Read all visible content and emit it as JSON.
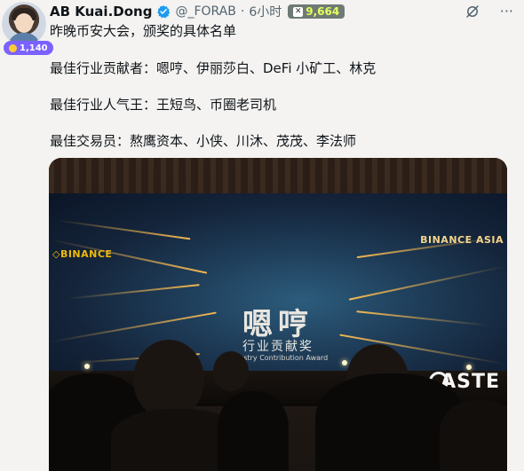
{
  "author": {
    "name": "AB Kuai.Dong",
    "handle": "@_FORAB",
    "separator": "·",
    "time": "6小时",
    "avatar_badge_count": "1,140",
    "score": "9,664"
  },
  "tweet": {
    "line1": "昨晚币安大会，颁奖的具体名单",
    "line2": "最佳行业贡献者：嗯哼、伊丽莎白、DeFi 小矿工、林克",
    "line3": "最佳行业人气王：王短鸟、币圈老司机",
    "line4": "最佳交易员：熬鹰资本、小侠、川沐、茂茂、李法师"
  },
  "photo": {
    "binance_left": "◇BINANCE",
    "binance_right": "BINANCE ASIA",
    "award_name": "嗯哼",
    "award_cn": "行业贡献奖",
    "award_en": "Industry Contribution Award",
    "sponsor": "ASTE"
  },
  "icons": {
    "verified": "verified-badge-icon",
    "grok": "grok-icon",
    "more": "more-icon"
  },
  "colors": {
    "verified": "#1d9bf0",
    "badge": "#7b61ff",
    "score_bg": "#6f7a74",
    "score_text": "#e5ff5e"
  }
}
